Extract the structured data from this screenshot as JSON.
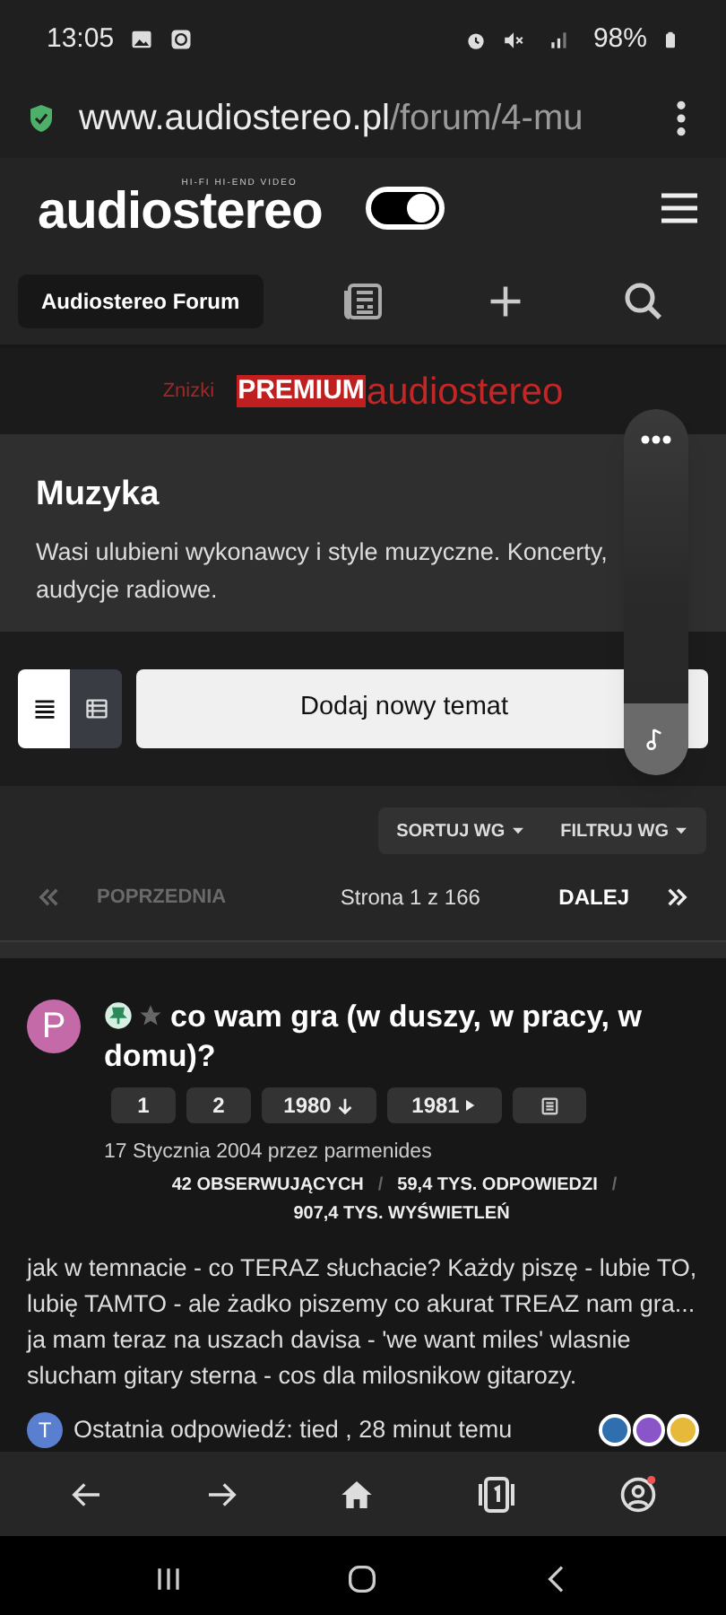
{
  "status_bar": {
    "time": "13:05",
    "battery": "98%"
  },
  "url_bar": {
    "host": "www.audiostereo.pl",
    "path": "/forum/4-mu"
  },
  "header": {
    "logo": "audiostereo",
    "logo_tagline": "HI-FI HI-END VIDEO",
    "theme_toggle": {
      "on": true
    }
  },
  "breadcrumb": "Audiostereo Forum",
  "banner": {
    "prefix": "Znizki",
    "badge": "PREMIUM",
    "brand": "audiostereo"
  },
  "forum": {
    "title": "Muzyka",
    "description": "Wasi ulubieni wykonawcy i style muzyczne. Koncerty, audycje radiowe."
  },
  "view_modes": [
    {
      "kind": "list",
      "selected": true
    },
    {
      "kind": "table",
      "selected": false
    }
  ],
  "new_topic_button": "Dodaj nowy temat",
  "filters": [
    "SORTUJ WG",
    "FILTRUJ WG"
  ],
  "pagination": {
    "previous": {
      "label": "POPRZEDNIA",
      "disabled": true
    },
    "page_info": "Strona 1 z 166",
    "next": {
      "label": "DALEJ",
      "disabled": false
    }
  },
  "topic": {
    "avatar": "P",
    "pinned": true,
    "title": "co wam gra (w duszy, w pracy, w domu)?",
    "pages": [
      {
        "kind": "page",
        "label": "1"
      },
      {
        "kind": "page",
        "label": "2"
      },
      {
        "kind": "unread",
        "label": "1980"
      },
      {
        "kind": "last",
        "label": "1981"
      },
      {
        "kind": "preview"
      }
    ],
    "meta": "17 Stycznia 2004 przez parmenides",
    "stats": [
      "42 OBSERWUJĄCYCH",
      "59,4 TYS. ODPOWIEDZI",
      "907,4 TYS. WYŚWIETLEŃ"
    ],
    "stat_separators": [
      "/",
      "/"
    ],
    "excerpt": "jak w temnacie - co TERAZ słuchacie? Każdy piszę - lubie TO, lubię TAMTO - ale żadko piszemy co akurat TREAZ nam gra... ja mam teraz na uszach davisa - 'we want miles' wlasnie slucham gitary sterna - cos dla milosnikow gitarozy.",
    "last_reply": {
      "avatar": "T",
      "text": "Ostatnia odpowiedź: tied , 28 minut temu"
    },
    "reactions": [
      {
        "color": "#2f6fb0"
      },
      {
        "color": "#8a55c9"
      },
      {
        "color": "#e6b93a"
      }
    ]
  }
}
